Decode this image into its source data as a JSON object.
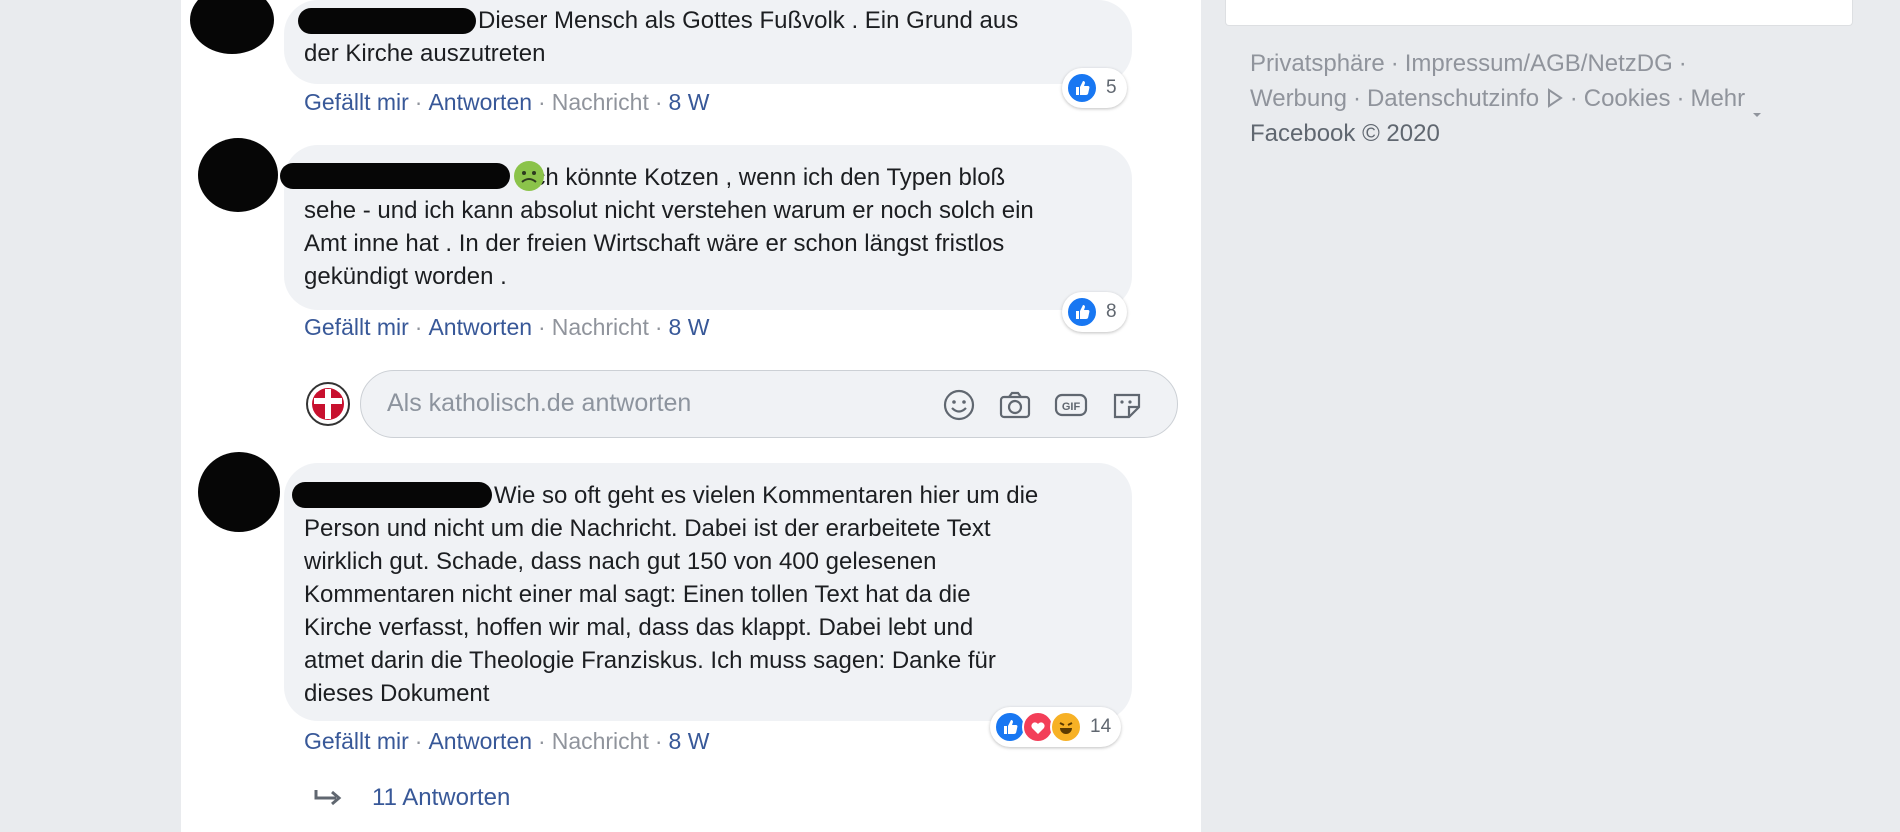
{
  "comments": [
    {
      "text": "Dieser Mensch als Gottes Fußvolk . Ein Grund aus der Kirche auszutreten",
      "line1": "Dieser Mensch als Gottes Fußvolk . Ein Grund aus",
      "line2": "der Kirche auszutreten",
      "reaction_count": "5",
      "actions": {
        "like": "Gefällt mir",
        "reply": "Antworten",
        "message": "Nachricht",
        "age": "8 W"
      }
    },
    {
      "line1": "ich könnte Kotzen , wenn ich den Typen bloß",
      "line2": "sehe - und ich kann absolut nicht verstehen warum er noch solch ein",
      "line3": "Amt inne hat . In der freien Wirtschaft wäre er schon längst fristlos",
      "line4": "gekündigt worden .",
      "reaction_count": "8",
      "actions": {
        "like": "Gefällt mir",
        "reply": "Antworten",
        "message": "Nachricht",
        "age": "8 W"
      }
    },
    {
      "line1": "Wie so oft geht es vielen Kommentaren hier um die",
      "line2": "Person und nicht um die Nachricht. Dabei ist der erarbeitete Text",
      "line3": "wirklich gut. Schade, dass nach gut 150 von 400 gelesenen",
      "line4": "Kommentaren nicht einer mal sagt: Einen tollen Text hat da die",
      "line5": "Kirche verfasst, hoffen wir mal, dass das klappt. Dabei lebt und",
      "line6": "atmet darin die Theologie Franziskus. Ich muss sagen: Danke für",
      "line7": "dieses Dokument",
      "reaction_count": "14",
      "actions": {
        "like": "Gefällt mir",
        "reply": "Antworten",
        "message": "Nachricht",
        "age": "8 W"
      }
    }
  ],
  "reply_box": {
    "placeholder": "Als katholisch.de antworten"
  },
  "more_replies": "11 Antworten",
  "footer": {
    "privacy": "Privatsphäre",
    "imprint": "Impressum/AGB/NetzDG",
    "ads": "Werbung",
    "datainfo": "Datenschutzinfo",
    "cookies": "Cookies",
    "more": "Mehr",
    "copyright": "Facebook © 2020"
  },
  "colors": {
    "link": "#385898",
    "muted": "#90949c",
    "bubble": "#f0f2f5",
    "like": "#1877f2",
    "love": "#f33e58"
  }
}
